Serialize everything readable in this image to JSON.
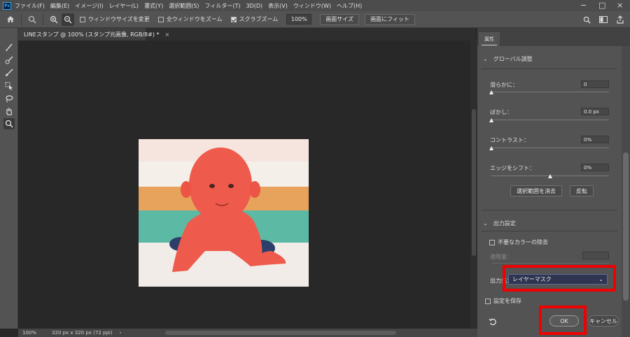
{
  "app": {
    "logo": "Ps",
    "menu": [
      "ファイル(F)",
      "編集(E)",
      "イメージ(I)",
      "レイヤー(L)",
      "書式(Y)",
      "選択範囲(S)",
      "フィルター(T)",
      "3D(D)",
      "表示(V)",
      "ウィンドウ(W)",
      "ヘルプ(H)"
    ],
    "window_controls": {
      "minimize": "−",
      "restore": "□",
      "close": "×"
    }
  },
  "options_bar": {
    "icons": {
      "home": "home-icon",
      "tool": "zoom-tool-icon",
      "zoom_in": "zoom-in-icon",
      "zoom_out": "zoom-out-icon",
      "search": "search-icon",
      "workspace": "workspace-icon",
      "share": "share-icon"
    },
    "checkboxes": [
      {
        "label": "ウィンドウサイズを変更",
        "checked": false
      },
      {
        "label": "全ウィンドウをズーム",
        "checked": false
      },
      {
        "label": "スクラブズーム",
        "checked": true
      }
    ],
    "zoom_value": "100%",
    "buttons": {
      "fit_size": "画面サイズ",
      "fit_screen": "画面にフィット"
    }
  },
  "document": {
    "tab_title": "LINEスタンプ @ 100% (スタンプ元画像, RGB/8#) *",
    "tab_close": "×",
    "status_zoom": "100%",
    "status_info": "320 px x 320 px (72 ppi)",
    "status_arrow": "›"
  },
  "toolbar": {
    "tools": [
      "brush-tool-icon",
      "refine-edge-brush-icon",
      "brush-alt-icon",
      "object-select-icon",
      "lasso-icon",
      "hand-tool-icon",
      "zoom-tool-icon"
    ],
    "active_tool": "zoom-tool-icon"
  },
  "panel": {
    "tab_label": "属性",
    "global_section": {
      "title": "グローバル調整",
      "sliders": [
        {
          "label": "滑らかに：",
          "value": "0",
          "position": 0.0
        },
        {
          "label": "ぼかし：",
          "value": "0.0 px",
          "position": 0.0
        },
        {
          "label": "コントラスト：",
          "value": "0%",
          "position": 0.0
        },
        {
          "label": "エッジをシフト：",
          "value": "0%",
          "position": 0.5
        }
      ],
      "buttons": {
        "clear_selection": "選択範囲を消去",
        "invert": "反転"
      }
    },
    "output_section": {
      "title": "出力設定",
      "decontaminate_label": "不要なカラーの除去",
      "decontaminate_checked": false,
      "amount_label": "適用量：",
      "output_label": "出力先：",
      "output_value": "レイヤーマスク",
      "save_settings_label": "設定を保存",
      "save_settings_checked": false
    },
    "footer": {
      "reset_icon": "reset-icon",
      "ok_label": "OK",
      "cancel_label": "キャンセル"
    }
  },
  "colors": {
    "highlight_red": "#f00000",
    "overlay_red": "#ee5a4c",
    "panel_bg": "#535353",
    "canvas_bg": "#282828"
  }
}
